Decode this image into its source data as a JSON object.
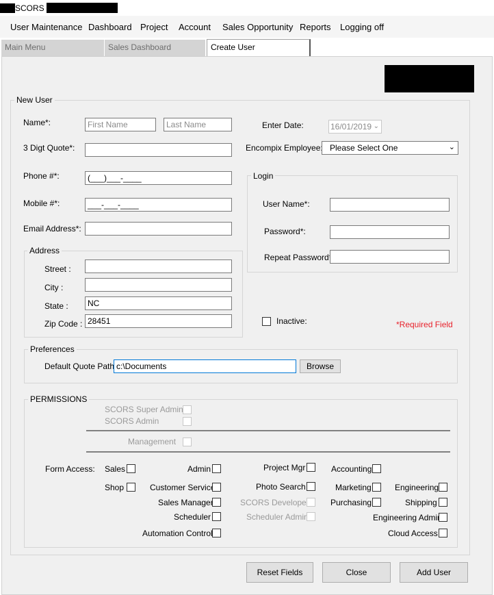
{
  "window": {
    "title": "SCORS -"
  },
  "menu": [
    "User Maintenance",
    "Dashboard",
    "Project",
    "Account",
    "Sales Opportunity",
    "Reports",
    "Logging off"
  ],
  "tabs": [
    {
      "label": "Main Menu",
      "active": false
    },
    {
      "label": "Sales Dashboard",
      "active": false
    },
    {
      "label": "Create User",
      "active": true
    }
  ],
  "new_user": {
    "group_label": "New User",
    "name_label": "Name*:",
    "first_name_placeholder": "First Name",
    "last_name_placeholder": "Last Name",
    "quote_label": "3 Digt Quote*:",
    "phone_label": "Phone #*:",
    "phone_value": "(___)___-____",
    "mobile_label": "Mobile #*:",
    "mobile_value": "___-___-____",
    "email_label": "Email Address*:",
    "enter_date_label": "Enter Date:",
    "enter_date_value": "16/01/2019",
    "employee_label": "Encompix Employee:",
    "employee_value": "Please Select One",
    "inactive_label": "Inactive:",
    "required_note": "*Required Field"
  },
  "address": {
    "group_label": "Address",
    "street_label": "Street :",
    "city_label": "City :",
    "state_label": "State :",
    "state_value": "NC",
    "zip_label": "Zip Code :",
    "zip_value": "28451"
  },
  "login": {
    "group_label": "Login",
    "username_label": "User Name*:",
    "password_label": "Password*:",
    "repeat_label": "Repeat Password*:"
  },
  "preferences": {
    "group_label": "Preferences",
    "path_label": "Default Quote  Path",
    "path_value": "c:\\Documents",
    "browse_label": "Browse"
  },
  "permissions": {
    "group_label": "PERMISSIONS",
    "super_admin": "SCORS Super Admin",
    "scors_admin": "SCORS Admin",
    "management": "Management",
    "form_access_label": "Form Access:",
    "sales": "Sales",
    "admin": "Admin",
    "project_mgr": "Project Mgr",
    "accounting": "Accounting",
    "shop": "Shop",
    "customer_service": "Customer Service",
    "photo_search": "Photo Search",
    "marketing": "Marketing",
    "engineering": "Engineering",
    "sales_manager": "Sales Manager",
    "scors_developer": "SCORS Developer",
    "purchasing": "Purchasing",
    "shipping": "Shipping",
    "scheduler": "Scheduler",
    "scheduler_admin": "Scheduler Admin",
    "engineering_admin": "Engineering Admin",
    "automation_controls": "Automation Controls",
    "cloud_access": "Cloud Access"
  },
  "actions": {
    "reset": "Reset Fields",
    "close": "Close",
    "add_user": "Add User"
  }
}
